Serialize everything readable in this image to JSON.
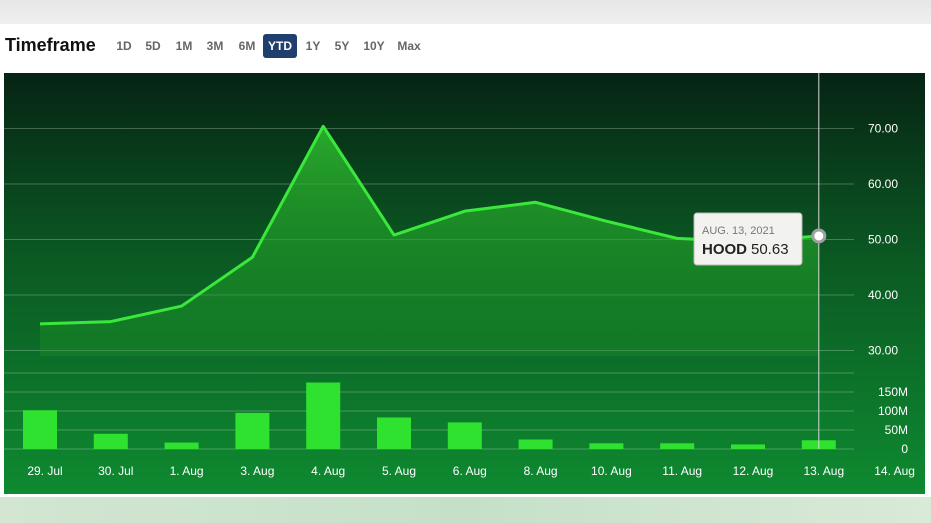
{
  "timeframe": {
    "title": "Timeframe",
    "options": [
      "1D",
      "5D",
      "1M",
      "3M",
      "6M",
      "YTD",
      "1Y",
      "5Y",
      "10Y",
      "Max"
    ],
    "active": "YTD"
  },
  "colors": {
    "line": "#39e83a",
    "volume": "#2ee22f",
    "active_button": "#1f3f6e",
    "background_top": "#062414",
    "background_bottom": "#0e8a30"
  },
  "tooltip": {
    "date": "AUG. 13, 2021",
    "symbol": "HOOD",
    "value": "50.63"
  },
  "chart_data": {
    "type": "line",
    "title": "",
    "x": [
      "29. Jul",
      "30. Jul",
      "1. Aug",
      "3. Aug",
      "4. Aug",
      "5. Aug",
      "6. Aug",
      "8. Aug",
      "10. Aug",
      "11. Aug",
      "12. Aug",
      "13. Aug"
    ],
    "x_tick_labels": [
      "29. Jul",
      "30. Jul",
      "1. Aug",
      "3. Aug",
      "4. Aug",
      "5. Aug",
      "6. Aug",
      "8. Aug",
      "10. Aug",
      "11. Aug",
      "12. Aug",
      "13. Aug",
      "14. Aug"
    ],
    "series": [
      {
        "name": "HOOD",
        "type": "area",
        "values": [
          34.8,
          35.2,
          38.0,
          46.8,
          70.4,
          50.8,
          55.1,
          56.7,
          53.3,
          50.2,
          49.6,
          50.63
        ]
      },
      {
        "name": "Volume",
        "type": "bar",
        "values_millions": [
          102,
          40,
          17,
          95,
          175,
          83,
          70,
          25,
          15,
          15,
          12,
          23
        ]
      }
    ],
    "price_axis": {
      "ticks": [
        "30.00",
        "40.00",
        "50.00",
        "60.00",
        "70.00"
      ],
      "range": [
        29,
        80
      ],
      "position": "right"
    },
    "volume_axis": {
      "ticks": [
        "0",
        "50M",
        "100M",
        "150M"
      ],
      "range": [
        0,
        200
      ],
      "position": "right"
    },
    "grid": true,
    "crosshair_x": "13. Aug"
  }
}
